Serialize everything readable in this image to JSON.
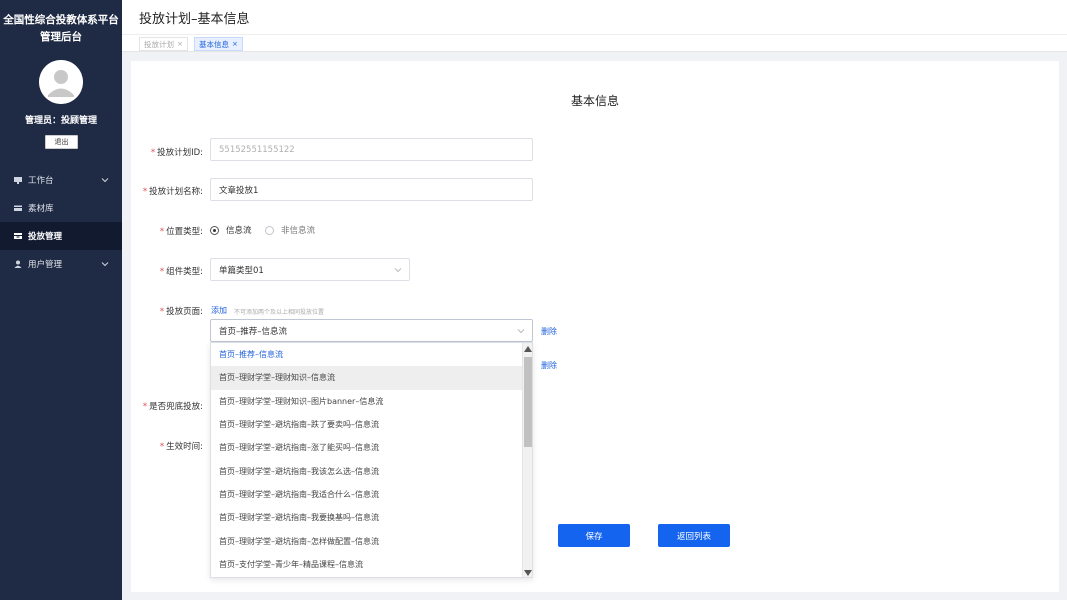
{
  "sidebar": {
    "title_line1": "全国性综合投教体系平台",
    "title_line2": "管理后台",
    "admin_label": "管理员：投顾管理",
    "logout_label": "退出",
    "items": [
      {
        "label": "工作台",
        "icon": "monitor-icon"
      },
      {
        "label": "素材库",
        "icon": "folder-icon"
      },
      {
        "label": "投放管理",
        "icon": "stack-icon"
      },
      {
        "label": "用户管理",
        "icon": "user-icon"
      }
    ]
  },
  "header": {
    "title": "投放计划–基本信息",
    "tabs": [
      {
        "label": "投放计划",
        "close": "×"
      },
      {
        "label": "基本信息",
        "close": "×"
      }
    ]
  },
  "form": {
    "title": "基本信息",
    "plan_id_label": "投放计划ID:",
    "plan_id_value": "55152551155122",
    "plan_name_label": "投放计划名称:",
    "plan_name_value": "文章投放1",
    "position_label": "位置类型:",
    "position_opt1": "信息流",
    "position_opt2": "非信息流",
    "component_label": "组件类型:",
    "component_value": "单篇类型01",
    "page_label": "投放页面:",
    "add_link": "添加",
    "add_hint": "不可添加两个及以上相同投放位置",
    "page_select_value": "首页–推荐–信息流",
    "delete_label": "删除",
    "fallback_label": "是否兜底投放:",
    "effective_label": "生效时间:",
    "save_label": "保存",
    "back_label": "返回列表"
  },
  "dropdown": {
    "options": [
      "首页–推荐–信息流",
      "首页–理财学堂–理财知识–信息流",
      "首页–理财学堂–理财知识–图片banner–信息流",
      "首页–理财学堂–避坑指南–跌了要卖吗–信息流",
      "首页–理财学堂–避坑指南–涨了能买吗–信息流",
      "首页–理财学堂–避坑指南–我该怎么选–信息流",
      "首页–理财学堂–避坑指南–我适合什么–信息流",
      "首页–理财学堂–避坑指南–我要换基吗–信息流",
      "首页–理财学堂–避坑指南–怎样做配置–信息流",
      "首页–支付学堂–青少年–精品课程–信息流"
    ],
    "selected_index": 0,
    "hover_index": 1
  },
  "colors": {
    "sidebar_bg": "#1f2a44",
    "accent": "#1464f0",
    "required": "#e34d4d"
  }
}
